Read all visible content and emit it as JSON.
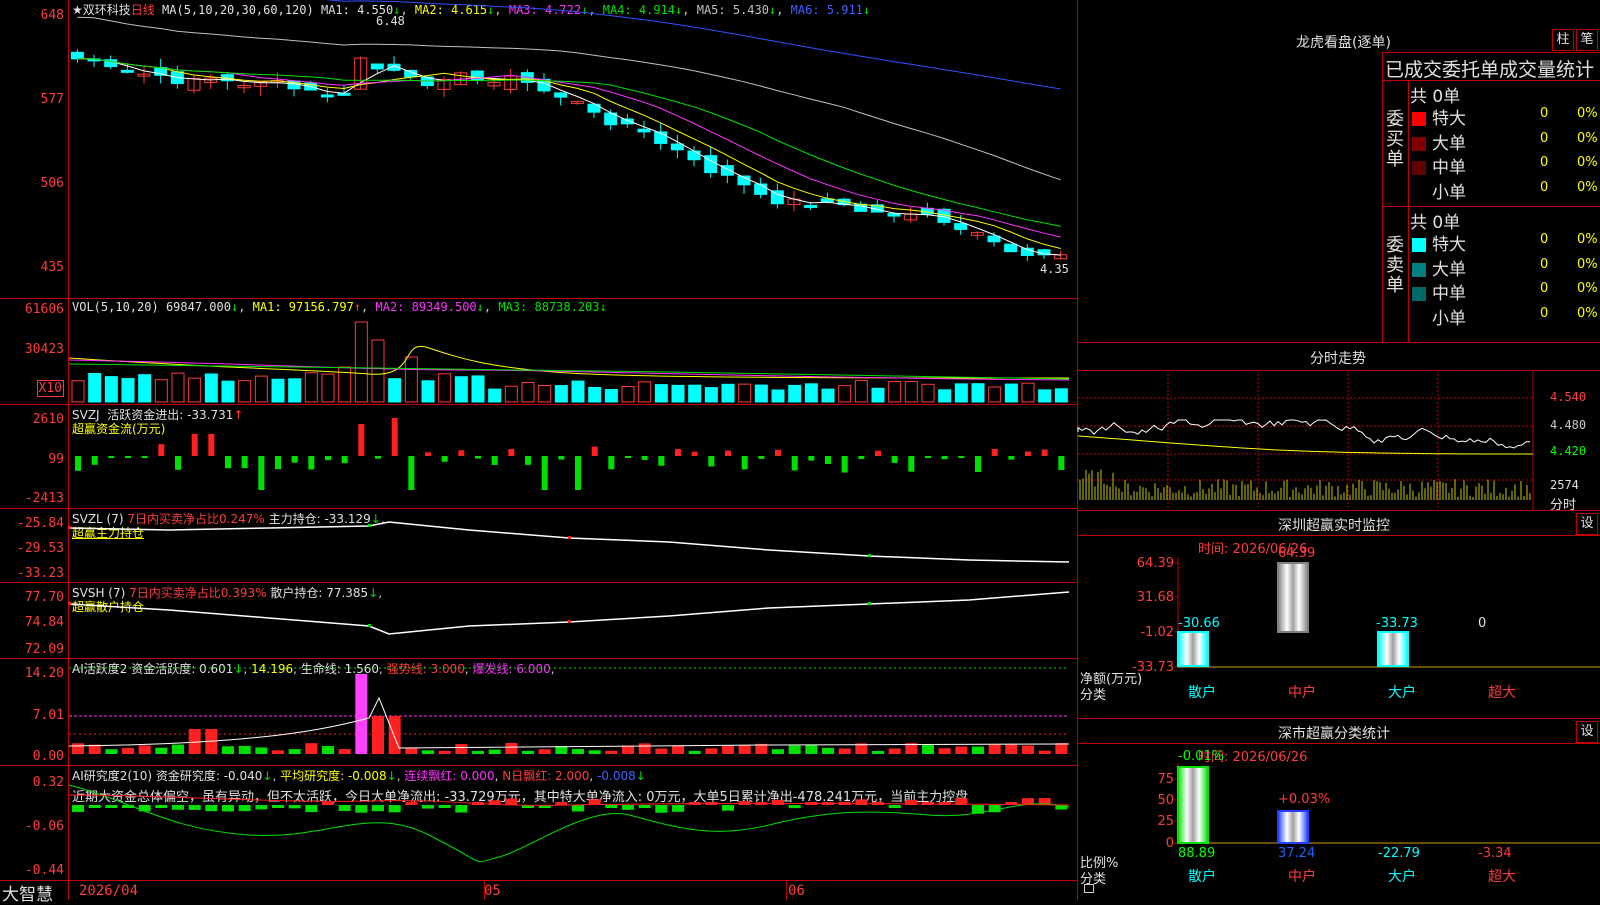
{
  "app": {
    "name": "大智慧"
  },
  "kline": {
    "stock_name": "★双环科技",
    "period": "日线",
    "ma_spec": "MA(5,10,20,30,60,120)",
    "ma1": "MA1: 4.550",
    "ma2": "MA2: 4.615",
    "ma3": "MA3: 4.722",
    "ma4": "MA4: 4.914",
    "ma5": "MA5: 5.430",
    "ma6": "MA6: 5.911",
    "high_marker": "6.48",
    "low_marker": "4.35",
    "y_labels": [
      "648",
      "577",
      "506",
      "435"
    ]
  },
  "vol": {
    "spec": "VOL(5,10,20)",
    "value": "69847.000",
    "ma1": "MA1: 97156.797",
    "ma2": "MA2: 89349.500",
    "ma3": "MA3: 88738.203",
    "y_labels": [
      "61606",
      "30423"
    ],
    "unit": "X10"
  },
  "svzj": {
    "spec": "SVZJ",
    "label": "活跃资金进出: -33.731",
    "name": "超赢资金流(万元)",
    "y_labels": [
      "2610",
      "99",
      "-2413"
    ]
  },
  "svzl": {
    "spec": "SVZL (7)",
    "ratio": "7日内买卖净占比0.247%",
    "hold": "主力持仓: -33.129",
    "name": "超赢主力持仓",
    "y_labels": [
      "-25.84",
      "-29.53",
      "-33.23"
    ]
  },
  "svsh": {
    "spec": "SVSH (7)",
    "ratio": "7日内买卖净占比0.393%",
    "hold": "散户持仓: 77.385",
    "name": "超赢散户持仓",
    "y_labels": [
      "77.70",
      "74.84",
      "72.09"
    ]
  },
  "ai_active": {
    "spec": "AI活跃度2",
    "a": "资金活跃度: 0.601",
    "b": "14.196",
    "c": "生命线: 1.560",
    "d": "强势线: 3.000",
    "e": "爆发线: 6.000",
    "y_labels": [
      "14.20",
      "7.01",
      "0.00"
    ]
  },
  "ai_research": {
    "spec": "AI研究度2(10)",
    "a": "资金研究度: -0.040",
    "b": "平均研究度: -0.008",
    "c": "连续飘红: 0.000",
    "d": "N日飘红: 2.000",
    "e": "-0.008",
    "comment": "近期大资金总体偏空，虽有异动，但不太活跃，今日大单净流出: -33.729万元，其中特大单净流入: 0万元，大单5日累计净出-478.241万元，当前主力控盘",
    "y_labels": [
      "0.32",
      "-0.06",
      "-0.44"
    ]
  },
  "x_axis": {
    "labels": [
      "2026/04",
      "05",
      "06"
    ]
  },
  "longhu": {
    "title": "龙虎看盘(逐单)",
    "btn1": "柱",
    "btn2": "笔",
    "subtitle": "已成交委托单成交量统计",
    "buy_label": "委买单",
    "sell_label": "委卖单",
    "buy_total": "共 0单",
    "sell_total": "共 0单",
    "buy_rows": [
      {
        "name": "特大",
        "count": "0",
        "pct": "0%",
        "color": "#ff0000"
      },
      {
        "name": "大单",
        "count": "0",
        "pct": "0%",
        "color": "#800000"
      },
      {
        "name": "中单",
        "count": "0",
        "pct": "0%",
        "color": "#600000"
      },
      {
        "name": "小单",
        "count": "0",
        "pct": "0%",
        "color": "#000000"
      }
    ],
    "sell_rows": [
      {
        "name": "特大",
        "count": "0",
        "pct": "0%",
        "color": "#00ffff"
      },
      {
        "name": "大单",
        "count": "0",
        "pct": "0%",
        "color": "#008080"
      },
      {
        "name": "中单",
        "count": "0",
        "pct": "0%",
        "color": "#006868"
      },
      {
        "name": "小单",
        "count": "0",
        "pct": "0%",
        "color": "#000000"
      }
    ]
  },
  "intraday": {
    "title": "分时走势",
    "y_labels": [
      "4.540",
      "4.480",
      "4.420"
    ],
    "vol_label": "2574",
    "footer": "分时"
  },
  "sz_monitor": {
    "title": "深圳超赢实时监控",
    "btn": "设",
    "date": "时间: 2026/06/26",
    "y_labels": [
      "64.39",
      "31.68",
      "-1.02",
      "-33.73"
    ],
    "y_title": "净额(万元)",
    "x_title": "分类",
    "categories": [
      "散户",
      "中户",
      "大户",
      "超大"
    ],
    "values": [
      -30.66,
      64.39,
      -33.73,
      0
    ],
    "value_labels": [
      "-30.66",
      "64.39",
      "-33.73",
      "0"
    ]
  },
  "sz_class": {
    "title": "深市超赢分类统计",
    "btn": "设",
    "date": "时间: 2026/06/26",
    "y_labels": [
      "75",
      "50",
      "25",
      "0"
    ],
    "y_title": "比例%",
    "x_title": "分类",
    "categories": [
      "散户",
      "中户",
      "大户",
      "超大"
    ],
    "top_labels": [
      "-0.01%",
      "+0.03%"
    ],
    "bottom_labels": [
      "88.89",
      "37.24",
      "-22.79",
      "-3.34"
    ]
  },
  "chart_data": [
    {
      "type": "bar",
      "title": "深圳超赢实时监控",
      "categories": [
        "散户",
        "中户",
        "大户",
        "超大"
      ],
      "values": [
        -30.66,
        64.39,
        -33.73,
        0
      ],
      "ylabel": "净额(万元)",
      "xlabel": "分类",
      "ylim": [
        -33.73,
        64.39
      ]
    },
    {
      "type": "bar",
      "title": "深市超赢分类统计",
      "categories": [
        "散户",
        "中户",
        "大户",
        "超大"
      ],
      "values": [
        88.89,
        37.24,
        -22.79,
        -3.34
      ],
      "ylabel": "比例%",
      "xlabel": "分类",
      "ylim": [
        0,
        75
      ]
    }
  ],
  "colors": {
    "up": "#ff3b3b",
    "down": "#00ffff",
    "grid": "#c00000"
  }
}
